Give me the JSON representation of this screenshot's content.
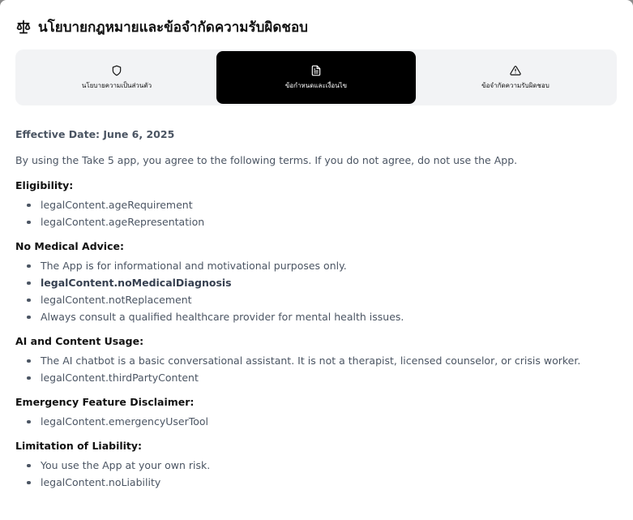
{
  "header": {
    "title": "นโยบายกฎหมายและข้อจำกัดความรับผิดชอบ",
    "icon": "scale-icon"
  },
  "tabs": [
    {
      "label": "นโยบายความเป็นส่วนตัว",
      "icon": "shield-icon",
      "active": false
    },
    {
      "label": "ข้อกำหนดและเงื่อนไข",
      "icon": "document-icon",
      "active": true
    },
    {
      "label": "ข้อจำกัดความรับผิดชอบ",
      "icon": "warning-icon",
      "active": false
    }
  ],
  "content": {
    "effective_date": "Effective Date: June 6, 2025",
    "intro": "By using the Take 5 app, you agree to the following terms. If you do not agree, do not use the App.",
    "sections": [
      {
        "title": "Eligibility:",
        "items": [
          {
            "text": "legalContent.ageRequirement",
            "bold": false
          },
          {
            "text": "legalContent.ageRepresentation",
            "bold": false
          }
        ]
      },
      {
        "title": "No Medical Advice:",
        "items": [
          {
            "text": "The App is for informational and motivational purposes only.",
            "bold": false
          },
          {
            "text": "legalContent.noMedicalDiagnosis",
            "bold": true
          },
          {
            "text": "legalContent.notReplacement",
            "bold": false
          },
          {
            "text": "Always consult a qualified healthcare provider for mental health issues.",
            "bold": false
          }
        ]
      },
      {
        "title": "AI and Content Usage:",
        "items": [
          {
            "text": "The AI chatbot is a basic conversational assistant. It is not a therapist, licensed counselor, or crisis worker.",
            "bold": false
          },
          {
            "text": "legalContent.thirdPartyContent",
            "bold": false
          }
        ]
      },
      {
        "title": "Emergency Feature Disclaimer:",
        "items": [
          {
            "text": "legalContent.emergencyUserTool",
            "bold": false
          }
        ]
      },
      {
        "title": "Limitation of Liability:",
        "items": [
          {
            "text": "You use the App at your own risk.",
            "bold": false
          },
          {
            "text": "legalContent.noLiability",
            "bold": false
          }
        ]
      }
    ]
  },
  "colors": {
    "active_tab_bg": "#000000",
    "tab_bar_bg": "#f2f3f5",
    "body_text": "#4b5563",
    "heading_text": "#111111"
  }
}
